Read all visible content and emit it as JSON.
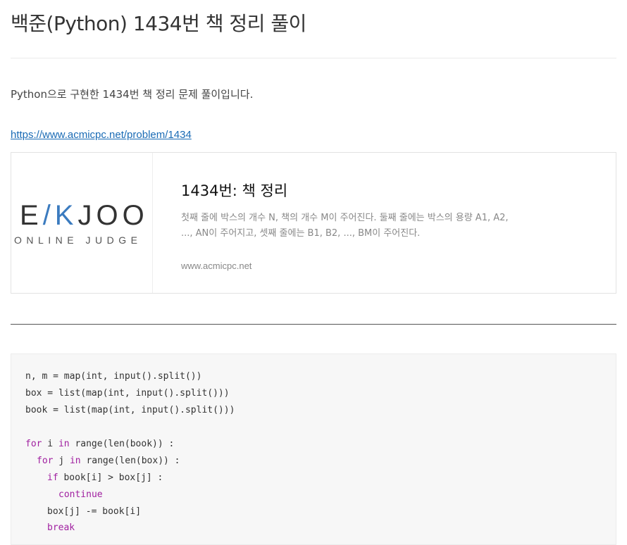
{
  "post": {
    "title": "백준(Python) 1434번 책 정리 풀이",
    "intro": "Python으로 구현한 1434번 책 정리 문제 풀이입니다.",
    "link": "https://www.acmicpc.net/problem/1434"
  },
  "og_card": {
    "logo_main_left": "E",
    "logo_main_k": "/K",
    "logo_main_right": "JOO",
    "logo_sub": "ONLINE JUDGE",
    "title": "1434번: 책 정리",
    "description": "첫째 줄에 박스의 개수 N, 책의 개수 M이 주어진다. 둘째 줄에는 박스의 용량 A1, A2, ..., AN이 주어지고, 셋째 줄에는 B1, B2, ..., BM이 주어진다.",
    "url": "www.acmicpc.net"
  },
  "code": {
    "line1": "n, m = map(int, input().split())",
    "line2": "box = list(map(int, input().split()))",
    "line3": "book = list(map(int, input().split()))",
    "line5_kw": "for",
    "line5_mid": " i ",
    "line5_kw2": "in",
    "line5_rest": " range(len(book)) :",
    "line6_kw": "for",
    "line6_mid": " j ",
    "line6_kw2": "in",
    "line6_rest": " range(len(box)) :",
    "line7_kw": "if",
    "line7_rest": " book[i] > box[j] :",
    "line8_kw": "continue",
    "line9": "box[j] -= book[i]",
    "line10_kw": "break"
  }
}
